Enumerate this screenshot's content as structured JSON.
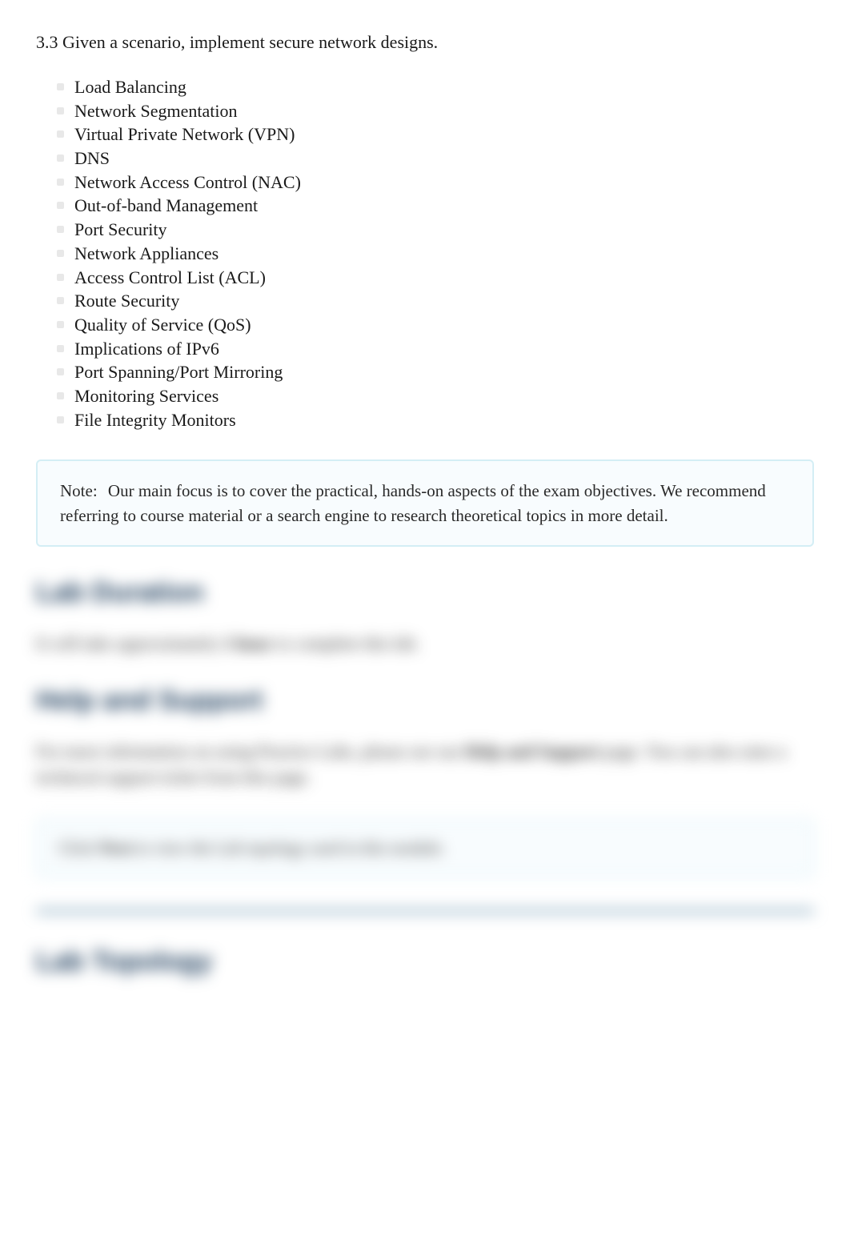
{
  "section": {
    "intro": "3.3 Given a scenario, implement secure network designs.",
    "bullets": [
      "Load Balancing",
      "Network Segmentation",
      "Virtual Private Network (VPN)",
      "DNS",
      "Network Access Control (NAC)",
      "Out-of-band Management",
      "Port Security",
      "Network Appliances",
      "Access Control List (ACL)",
      "Route Security",
      "Quality of Service (QoS)",
      "Implications of IPv6",
      "Port Spanning/Port Mirroring",
      "Monitoring Services",
      "File Integrity Monitors"
    ]
  },
  "note": {
    "label": "Note:",
    "text": "Our main focus is to cover the practical, hands-on aspects of the exam objectives. We recommend referring to course material or a search engine to research theoretical topics in more detail."
  },
  "blurred": {
    "lab_duration_heading": "Lab Duration",
    "duration_pre": "It will take approximately ",
    "duration_bold": "1 hour",
    "duration_post": " to complete this lab.",
    "help_heading": "Help and Support",
    "help_pre": "For more information on using Practice Labs, please see our ",
    "help_bold": "Help and Support",
    "help_post": " page. You can also raise a technical support ticket from this page.",
    "cta_pre": "Click ",
    "cta_bold": "Next",
    "cta_post": " to view the Lab topology used in this module.",
    "topology_heading": "Lab Topology"
  }
}
